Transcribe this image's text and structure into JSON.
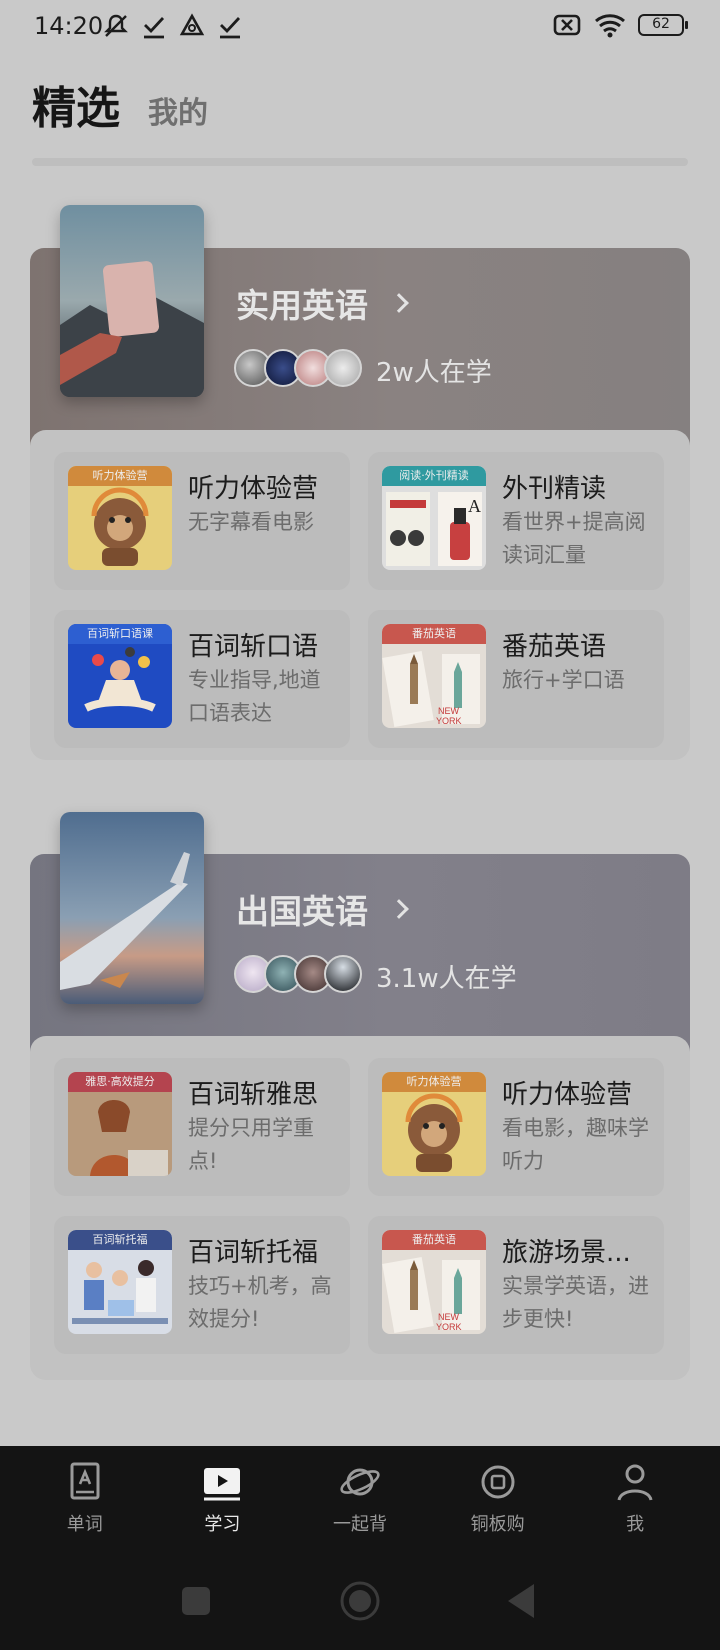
{
  "status": {
    "time": "14:20",
    "battery": "62",
    "icons": [
      "mute-icon",
      "check-icon",
      "warning-icon",
      "check-icon",
      "sim-off-icon",
      "wifi-icon",
      "battery-icon"
    ]
  },
  "tabs": {
    "selected": "精选",
    "mine": "我的"
  },
  "sections": [
    {
      "title": "实用英语",
      "learners": "2w人在学",
      "courses": [
        {
          "tag": "听力体验营",
          "title": "听力体验营",
          "desc": "无字幕看电影",
          "color": "#d08a3c"
        },
        {
          "tag": "阅读·外刊精读",
          "title": "外刊精读",
          "desc": "看世界+提高阅读词汇量",
          "color": "#2f9aa0"
        },
        {
          "tag": "百词斩口语课",
          "title": "百词斩口语",
          "desc": "专业指导,地道口语表达",
          "color": "#3458a8"
        },
        {
          "tag": "番茄英语",
          "title": "番茄英语",
          "desc": "旅行+学口语",
          "color": "#c8574e"
        }
      ]
    },
    {
      "title": "出国英语",
      "learners": "3.1w人在学",
      "courses": [
        {
          "tag": "雅思·高效提分",
          "title": "百词斩雅思",
          "desc": "提分只用学重点!",
          "color": "#b4444f"
        },
        {
          "tag": "听力体验营",
          "title": "听力体验营",
          "desc": "看电影，趣味学听力",
          "color": "#d08a3c"
        },
        {
          "tag": "百词斩托福",
          "title": "百词斩托福",
          "desc": "技巧+机考，高效提分!",
          "color": "#3a4f8a"
        },
        {
          "tag": "番茄英语",
          "title": "旅游场景...",
          "desc": "实景学英语，进步更快!",
          "color": "#c8574e"
        }
      ]
    }
  ],
  "bottom_nav": [
    {
      "label": "单词",
      "icon": "word-book-icon"
    },
    {
      "label": "学习",
      "icon": "play-video-icon",
      "active": true
    },
    {
      "label": "一起背",
      "icon": "planet-icon"
    },
    {
      "label": "铜板购",
      "icon": "coin-icon"
    },
    {
      "label": "我",
      "icon": "profile-icon"
    }
  ],
  "system_nav": [
    "recents-button",
    "home-button",
    "back-button"
  ]
}
